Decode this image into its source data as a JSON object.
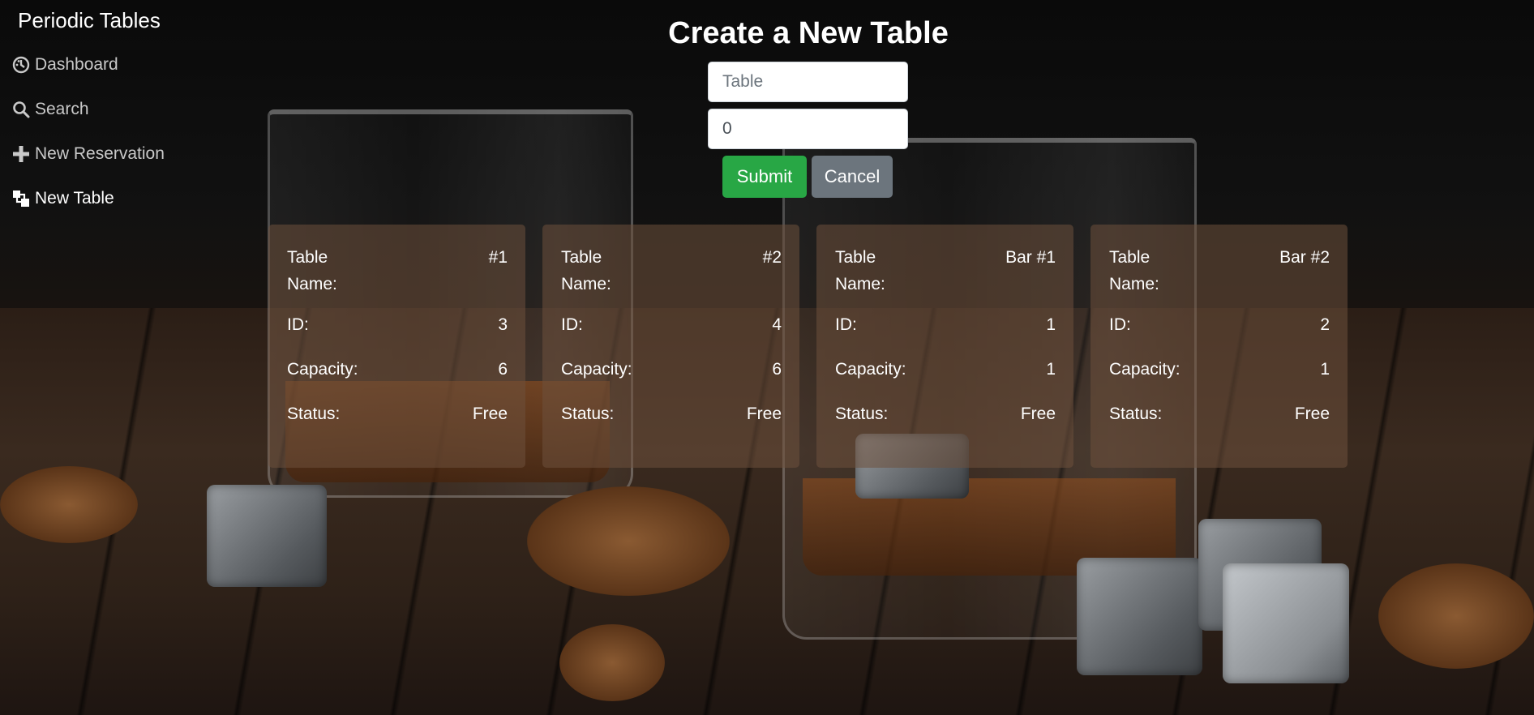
{
  "sidebar": {
    "brand": "Periodic Tables",
    "items": [
      {
        "label": "Dashboard",
        "icon": "dashboard-icon"
      },
      {
        "label": "Search",
        "icon": "search-icon"
      },
      {
        "label": "New Reservation",
        "icon": "plus-icon"
      },
      {
        "label": "New Table",
        "icon": "stacked-squares-icon"
      }
    ]
  },
  "form": {
    "title": "Create a New Table",
    "table_name_placeholder": "Table",
    "capacity_value": "0",
    "submit_label": "Submit",
    "cancel_label": "Cancel"
  },
  "labels": {
    "table_name": "Table Name:",
    "id": "ID:",
    "capacity": "Capacity:",
    "status": "Status:"
  },
  "tables": [
    {
      "name": "#1",
      "id": "3",
      "capacity": "6",
      "status": "Free"
    },
    {
      "name": "#2",
      "id": "4",
      "capacity": "6",
      "status": "Free"
    },
    {
      "name": "Bar #1",
      "id": "1",
      "capacity": "1",
      "status": "Free"
    },
    {
      "name": "Bar #2",
      "id": "2",
      "capacity": "1",
      "status": "Free"
    }
  ],
  "colors": {
    "submit": "#28a745",
    "cancel": "#6c757d",
    "card_background": "rgba(110,80,60,0.55)"
  }
}
